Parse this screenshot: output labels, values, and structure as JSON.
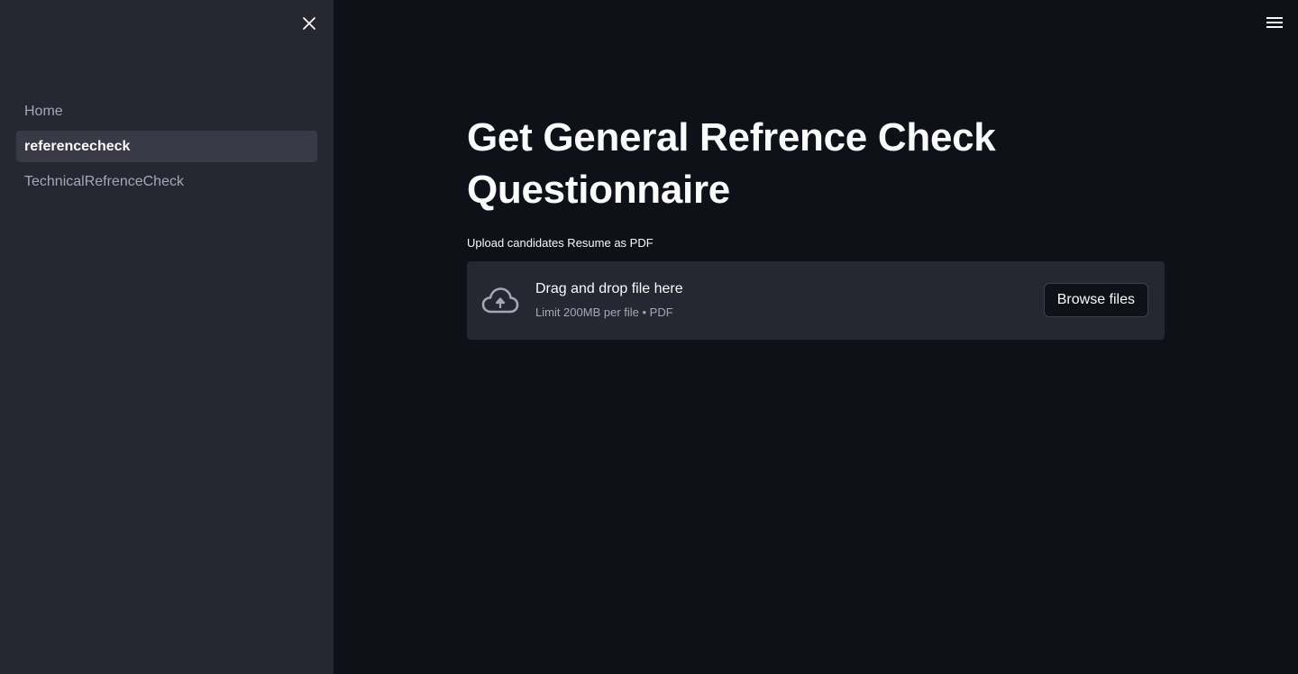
{
  "sidebar": {
    "close_icon": "close-icon",
    "items": [
      {
        "label": "Home",
        "active": false
      },
      {
        "label": "referencecheck",
        "active": true
      },
      {
        "label": "TechnicalRefrenceCheck",
        "active": false
      }
    ]
  },
  "header": {
    "menu_icon": "hamburger-menu-icon"
  },
  "main": {
    "title_line1": "Get General Refrence Check",
    "title_line2": "Questionnaire",
    "uploader": {
      "label": "Upload candidates Resume as PDF",
      "icon": "cloud-upload-icon",
      "primary_text": "Drag and drop file here",
      "secondary_text": "Limit 200MB per file • PDF",
      "button_label": "Browse files"
    }
  },
  "colors": {
    "background": "#0e1117",
    "sidebar": "#262730",
    "active_item": "#393a45",
    "text": "#fafafa",
    "muted_text": "#a3a8b8"
  }
}
